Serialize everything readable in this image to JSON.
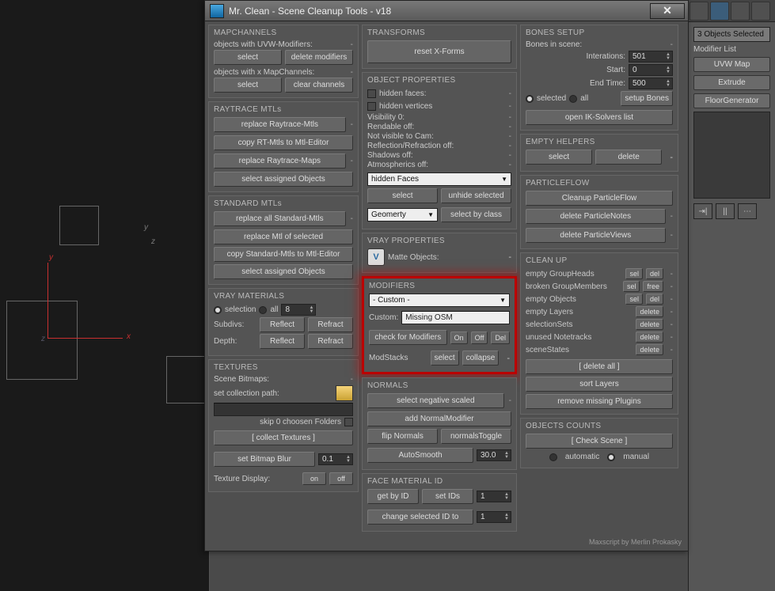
{
  "window": {
    "title": "Mr. Clean - Scene Cleanup Tools - v18"
  },
  "mapchannels": {
    "title": "MAPCHANNELS",
    "label1": "objects with UVW-Modifiers:",
    "dash1": "-",
    "btn_select1": "select",
    "btn_delmod": "delete modifiers",
    "label2": "objects with x MapChannels:",
    "dash2": "-",
    "btn_select2": "select",
    "btn_clear": "clear channels"
  },
  "raytrace": {
    "title": "RAYTRACE MTLs",
    "btn_replace": "replace Raytrace-Mtls",
    "dash1": "-",
    "btn_copy": "copy RT-Mtls to Mtl-Editor",
    "btn_replacemaps": "replace Raytrace-Maps",
    "dash2": "-",
    "btn_assigned": "select assigned Objects"
  },
  "standardmtls": {
    "title": "STANDARD MTLs",
    "btn_replaceall": "replace all Standard-Mtls",
    "dash1": "-",
    "btn_replacesel": "replace Mtl of selected",
    "btn_copy": "copy Standard-Mtls to Mtl-Editor",
    "btn_assigned": "select assigned Objects"
  },
  "vraymat": {
    "title": "VRAY MATERIALS",
    "radio_sel": "selection",
    "radio_all": "all",
    "spin_val": "8",
    "label_subdivs": "Subdivs:",
    "btn_reflect1": "Reflect",
    "btn_refract1": "Refract",
    "label_depth": "Depth:",
    "btn_reflect2": "Reflect",
    "btn_refract2": "Refract"
  },
  "textures": {
    "title": "TEXTURES",
    "label_bitmaps": "Scene Bitmaps:",
    "dash": "-",
    "label_setpath": "set collection path:",
    "label_skip": "skip 0 choosen Folders",
    "btn_collect": "[ collect Textures ]",
    "btn_setblur": "set Bitmap Blur",
    "spin_blur": "0.1",
    "label_display": "Texture Display:",
    "btn_on": "on",
    "btn_off": "off"
  },
  "transforms": {
    "title": "TRANSFORMS",
    "btn_reset": "reset X-Forms"
  },
  "objprops": {
    "title": "OBJECT PROPERTIES",
    "hidden_faces": "hidden faces:",
    "hidden_verts": "hidden vertices",
    "vis0": "Visibility 0:",
    "rendoff": "Rendable off:",
    "notvis": "Not visible to Cam:",
    "reflref": "Reflection/Refraction off:",
    "shadows": "Shadows off:",
    "atmos": "Atmospherics off:",
    "dash": "-",
    "select_hidden": "hidden Faces",
    "btn_select": "select",
    "btn_unhide": "unhide selected",
    "select_geom": "Geomerty",
    "btn_selclass": "select by class"
  },
  "vrayprops": {
    "title": "VRAY PROPERTIES",
    "label_matte": "Matte Objects:",
    "dash": "-"
  },
  "modifiers": {
    "title": "MODIFIERS",
    "select_custom": "- Custom -",
    "label_custom": "Custom:",
    "field_custom": "Missing OSM",
    "btn_check": "check for Modifiers",
    "btn_on": "On",
    "btn_off": "Off",
    "btn_del": "Del",
    "label_stacks": "ModStacks",
    "btn_select": "select",
    "btn_collapse": "collapse",
    "dash": "-"
  },
  "normals": {
    "title": "NORMALS",
    "btn_negscaled": "select negative scaled",
    "dash": "-",
    "btn_addnm": "add NormalModifier",
    "btn_flip": "flip Normals",
    "btn_toggle": "normalsToggle",
    "btn_autosmooth": "AutoSmooth",
    "spin_smooth": "30.0"
  },
  "facemat": {
    "title": "FACE MATERIAL ID",
    "btn_getbyid": "get by ID",
    "btn_setids": "set IDs",
    "spin1": "1",
    "label_change": "change selected ID to",
    "spin2": "1"
  },
  "bones": {
    "title": "BONES SETUP",
    "label_inscene": "Bones in scene:",
    "dash": "-",
    "label_inter": "Interations:",
    "spin_inter": "501",
    "label_start": "Start:",
    "spin_start": "0",
    "label_end": "End Time:",
    "spin_end": "500",
    "radio_selected": "selected",
    "radio_all": "all",
    "btn_setup": "setup Bones",
    "btn_ik": "open IK-Solvers list"
  },
  "emptyhelpers": {
    "title": "EMPTY HELPERS",
    "btn_select": "select",
    "btn_delete": "delete",
    "dash": "-"
  },
  "pflow": {
    "title": "PARTICLEFLOW",
    "btn_cleanup": "Cleanup ParticleFlow",
    "btn_delnotes": "delete ParticleNotes",
    "dash1": "-",
    "btn_delviews": "delete ParticleViews",
    "dash2": "-"
  },
  "cleanup": {
    "title": "CLEAN UP",
    "rows": [
      {
        "label": "empty GroupHeads",
        "b1": "sel",
        "b2": "del"
      },
      {
        "label": "broken GroupMembers",
        "b1": "sel",
        "b2": "free"
      },
      {
        "label": "empty Objects",
        "b1": "sel",
        "b2": "del"
      },
      {
        "label": "empty Layers",
        "b1": "",
        "b2": "delete"
      },
      {
        "label": "selectionSets",
        "b1": "",
        "b2": "delete"
      },
      {
        "label": "unused Notetracks",
        "b1": "",
        "b2": "delete"
      },
      {
        "label": "sceneStates",
        "b1": "",
        "b2": "delete"
      }
    ],
    "btn_delall": "[ delete all ]",
    "btn_sort": "sort Layers",
    "btn_remplugins": "remove missing Plugins"
  },
  "objcounts": {
    "title": "OBJECTS COUNTS",
    "btn_check": "[ Check Scene ]",
    "radio_auto": "automatic",
    "radio_manual": "manual"
  },
  "footer": "Maxscript by Merlin Prokasky",
  "rightpanel": {
    "selected": "3 Objects Selected",
    "modlist": "Modifier List",
    "buttons": [
      "UVW Map",
      "Extrude",
      "FloorGenerator"
    ]
  }
}
